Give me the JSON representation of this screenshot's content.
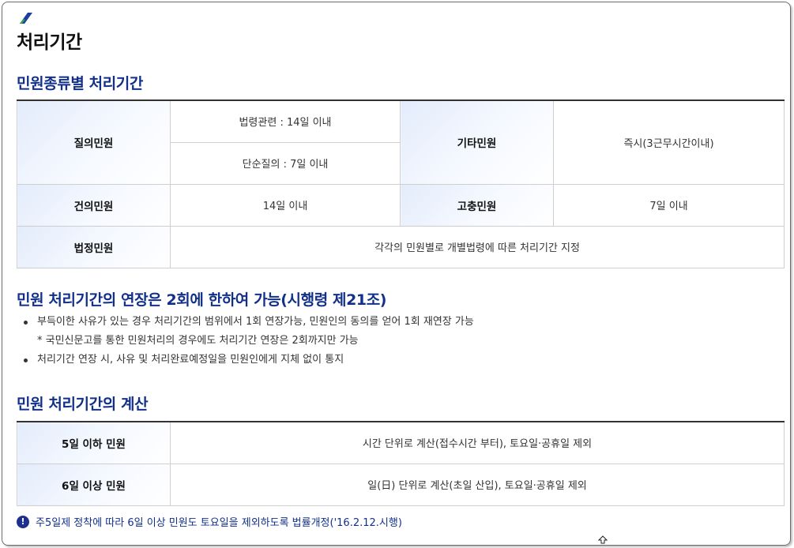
{
  "page": {
    "title": "처리기간"
  },
  "section1": {
    "title": "민원종류별 처리기간",
    "rows": {
      "inquiry": {
        "label": "질의민원",
        "law": "법령관련 : 14일 이내",
        "simple": "단순질의 : 7일 이내"
      },
      "other": {
        "label": "기타민원",
        "value": "즉시(3근무시간이내)"
      },
      "suggestion": {
        "label": "건의민원",
        "value": "14일 이내"
      },
      "grievance": {
        "label": "고충민원",
        "value": "7일 이내"
      },
      "statutory": {
        "label": "법정민원",
        "value": "각각의 민원별로 개별법령에 따른 처리기간 지정"
      }
    }
  },
  "section2": {
    "title": "민원 처리기간의 연장은 2회에 한하여 가능(시행령 제21조)",
    "bullet1": "부득이한 사유가 있는 경우 처리기간의 범위에서 1회 연장가능, 민원인의 동의를 얻어 1회 재연장 가능",
    "sub1": "* 국민신문고를 통한 민원처리의 경우에도 처리기간 연장은 2회까지만 가능",
    "bullet2": "처리기간 연장 시, 사유 및 처리완료예정일을 민원인에게 지체 없이 통지"
  },
  "section3": {
    "title": "민원 처리기간의 계산",
    "rows": [
      {
        "label": "5일 이하 민원",
        "value": "시간 단위로 계산(접수시간 부터), 토요일·공휴일 제외"
      },
      {
        "label": "6일 이상 민원",
        "value": "일(日) 단위로 계산(초일 산입), 토요일·공휴일 제외"
      }
    ]
  },
  "note": {
    "icon": "!",
    "text": "주5일제 정착에 따라 6일 이상 민원도 토요일을 제외하도록 법률개정('16.2.12.시행)"
  },
  "colors": {
    "accent": "#12308a",
    "header_bg": "#e8f0fc",
    "logo_green": "#2aa84a",
    "logo_blue": "#1d3f9e"
  },
  "icons": {
    "logo": "slash-logo-icon",
    "note": "exclamation-circle-icon",
    "cursor": "mouse-cursor-icon"
  }
}
